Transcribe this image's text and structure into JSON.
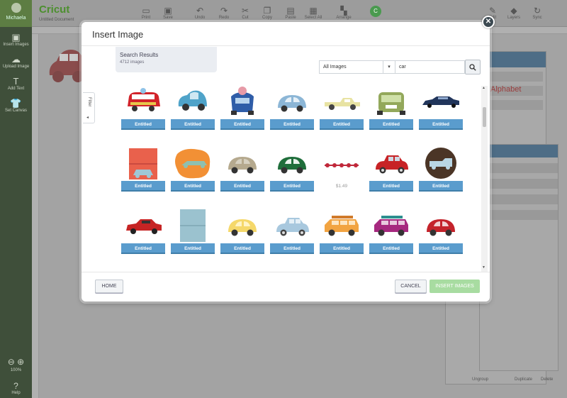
{
  "app": {
    "logo": "Cricut",
    "document_name": "Untitled Document",
    "user": "Michaela",
    "left_rail": [
      {
        "label": "Insert Images",
        "icon": "image-icon"
      },
      {
        "label": "Upload Image",
        "icon": "upload-icon"
      },
      {
        "label": "Add Text",
        "icon": "text-icon"
      },
      {
        "label": "Set Canvas",
        "icon": "shirt-icon"
      }
    ],
    "zoom_label": "100%",
    "help_label": "Help",
    "toolbar": [
      {
        "label": "Print",
        "icon": "folder-icon"
      },
      {
        "label": "Save",
        "icon": "save-icon"
      },
      {
        "label": "Undo",
        "icon": "undo-icon"
      },
      {
        "label": "Redo",
        "icon": "redo-icon"
      },
      {
        "label": "Cut",
        "icon": "cut-icon"
      },
      {
        "label": "Copy",
        "icon": "copy-icon"
      },
      {
        "label": "Paste",
        "icon": "paste-icon"
      },
      {
        "label": "Select All",
        "icon": "grid-icon"
      },
      {
        "label": "Arrange",
        "icon": "arrange-icon"
      }
    ],
    "go_label": "Go",
    "right_tools": [
      {
        "label": "Edit",
        "icon": "pencil-icon"
      },
      {
        "label": "Layers",
        "icon": "layers-icon"
      },
      {
        "label": "Sync",
        "icon": "sync-icon"
      }
    ],
    "text_panel_sample": "Alphabet",
    "bottom_tools": [
      "Ungroup",
      "Duplicate",
      "Delete"
    ]
  },
  "modal": {
    "title": "Insert Image",
    "results": {
      "title": "Search Results",
      "count": "4712 images"
    },
    "filter_tab": "Filter",
    "category_select": "All Images",
    "search_value": "car",
    "tiles": [
      {
        "badge": "Entitled",
        "art": "bus-red"
      },
      {
        "badge": "Entitled",
        "art": "bubble-blue"
      },
      {
        "badge": "Entitled",
        "art": "pig-car"
      },
      {
        "badge": "Entitled",
        "art": "beetle-blue"
      },
      {
        "badge": "Entitled",
        "art": "truck-yellow"
      },
      {
        "badge": "Entitled",
        "art": "jeep-green"
      },
      {
        "badge": "Entitled",
        "art": "limo-navy"
      },
      {
        "badge": "Entitled",
        "art": "square-red"
      },
      {
        "badge": "Entitled",
        "art": "blob-orange"
      },
      {
        "badge": "Entitled",
        "art": "beetle-floral"
      },
      {
        "badge": "Entitled",
        "art": "beetle-green"
      },
      {
        "badge": "$1.49",
        "art": "chain-red",
        "is_price": true
      },
      {
        "badge": "Entitled",
        "art": "sport-red"
      },
      {
        "badge": "Entitled",
        "art": "circle-brown"
      },
      {
        "badge": "Entitled",
        "art": "muscle-red"
      },
      {
        "badge": "Entitled",
        "art": "square-teal"
      },
      {
        "badge": "Entitled",
        "art": "beetle-yellow"
      },
      {
        "badge": "Entitled",
        "art": "sedan-blue"
      },
      {
        "badge": "Entitled",
        "art": "wagon-orange"
      },
      {
        "badge": "Entitled",
        "art": "wagon-pink"
      },
      {
        "badge": "Entitled",
        "art": "beetle-red"
      }
    ],
    "buttons": {
      "home": "HOME",
      "cancel": "CANCEL",
      "insert": "INSERT IMAGES"
    }
  },
  "colors": {
    "badge_blue": "#5a9ccd",
    "insert_green": "#a8dca1",
    "rail_green": "#3f4f3a"
  }
}
